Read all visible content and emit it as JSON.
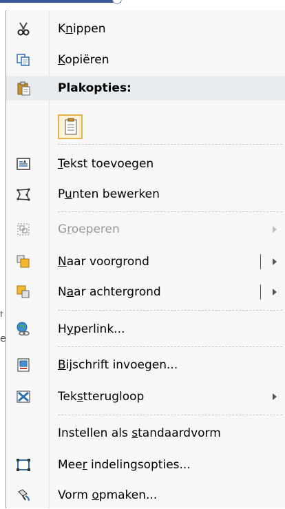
{
  "menu": {
    "items": [
      {
        "pre": "K",
        "u": "n",
        "post": "ippen",
        "icon": "scissors-icon"
      },
      {
        "pre": "",
        "u": "K",
        "post": "opiëren",
        "icon": "copy-icon"
      },
      {
        "pre": "Plakopties:",
        "u": "",
        "post": "",
        "icon": "paste-icon"
      },
      {
        "pre": "",
        "u": "T",
        "post": "ekst toevoegen",
        "icon": "textbox-icon"
      },
      {
        "pre": "P",
        "u": "u",
        "post": "nten bewerken",
        "icon": "edit-points-icon"
      },
      {
        "pre": "G",
        "u": "r",
        "post": "oeperen",
        "icon": "group-icon"
      },
      {
        "pre": "",
        "u": "N",
        "post": "aar voorgrond",
        "icon": "bring-forward-icon"
      },
      {
        "pre": "N",
        "u": "a",
        "post": "ar achtergrond",
        "icon": "send-backward-icon"
      },
      {
        "pre": "H",
        "u": "y",
        "post": "perlink...",
        "icon": "hyperlink-icon"
      },
      {
        "pre": "",
        "u": "B",
        "post": "ijschrift invoegen...",
        "icon": "caption-icon"
      },
      {
        "pre": "Tek",
        "u": "s",
        "post": "tterugloop",
        "icon": "text-wrap-icon"
      },
      {
        "pre": "Instellen als ",
        "u": "s",
        "post": "tandaardvorm",
        "icon": ""
      },
      {
        "pre": "Mee",
        "u": "r",
        "post": " indelingsopties...",
        "icon": "layout-options-icon"
      },
      {
        "pre": "Vorm ",
        "u": "o",
        "post": "pmaken...",
        "icon": "format-shape-icon"
      }
    ],
    "paste_option_icon": "paste-keep-text-icon"
  },
  "background": {
    "fragment_1": "t",
    "fragment_2": "e"
  }
}
